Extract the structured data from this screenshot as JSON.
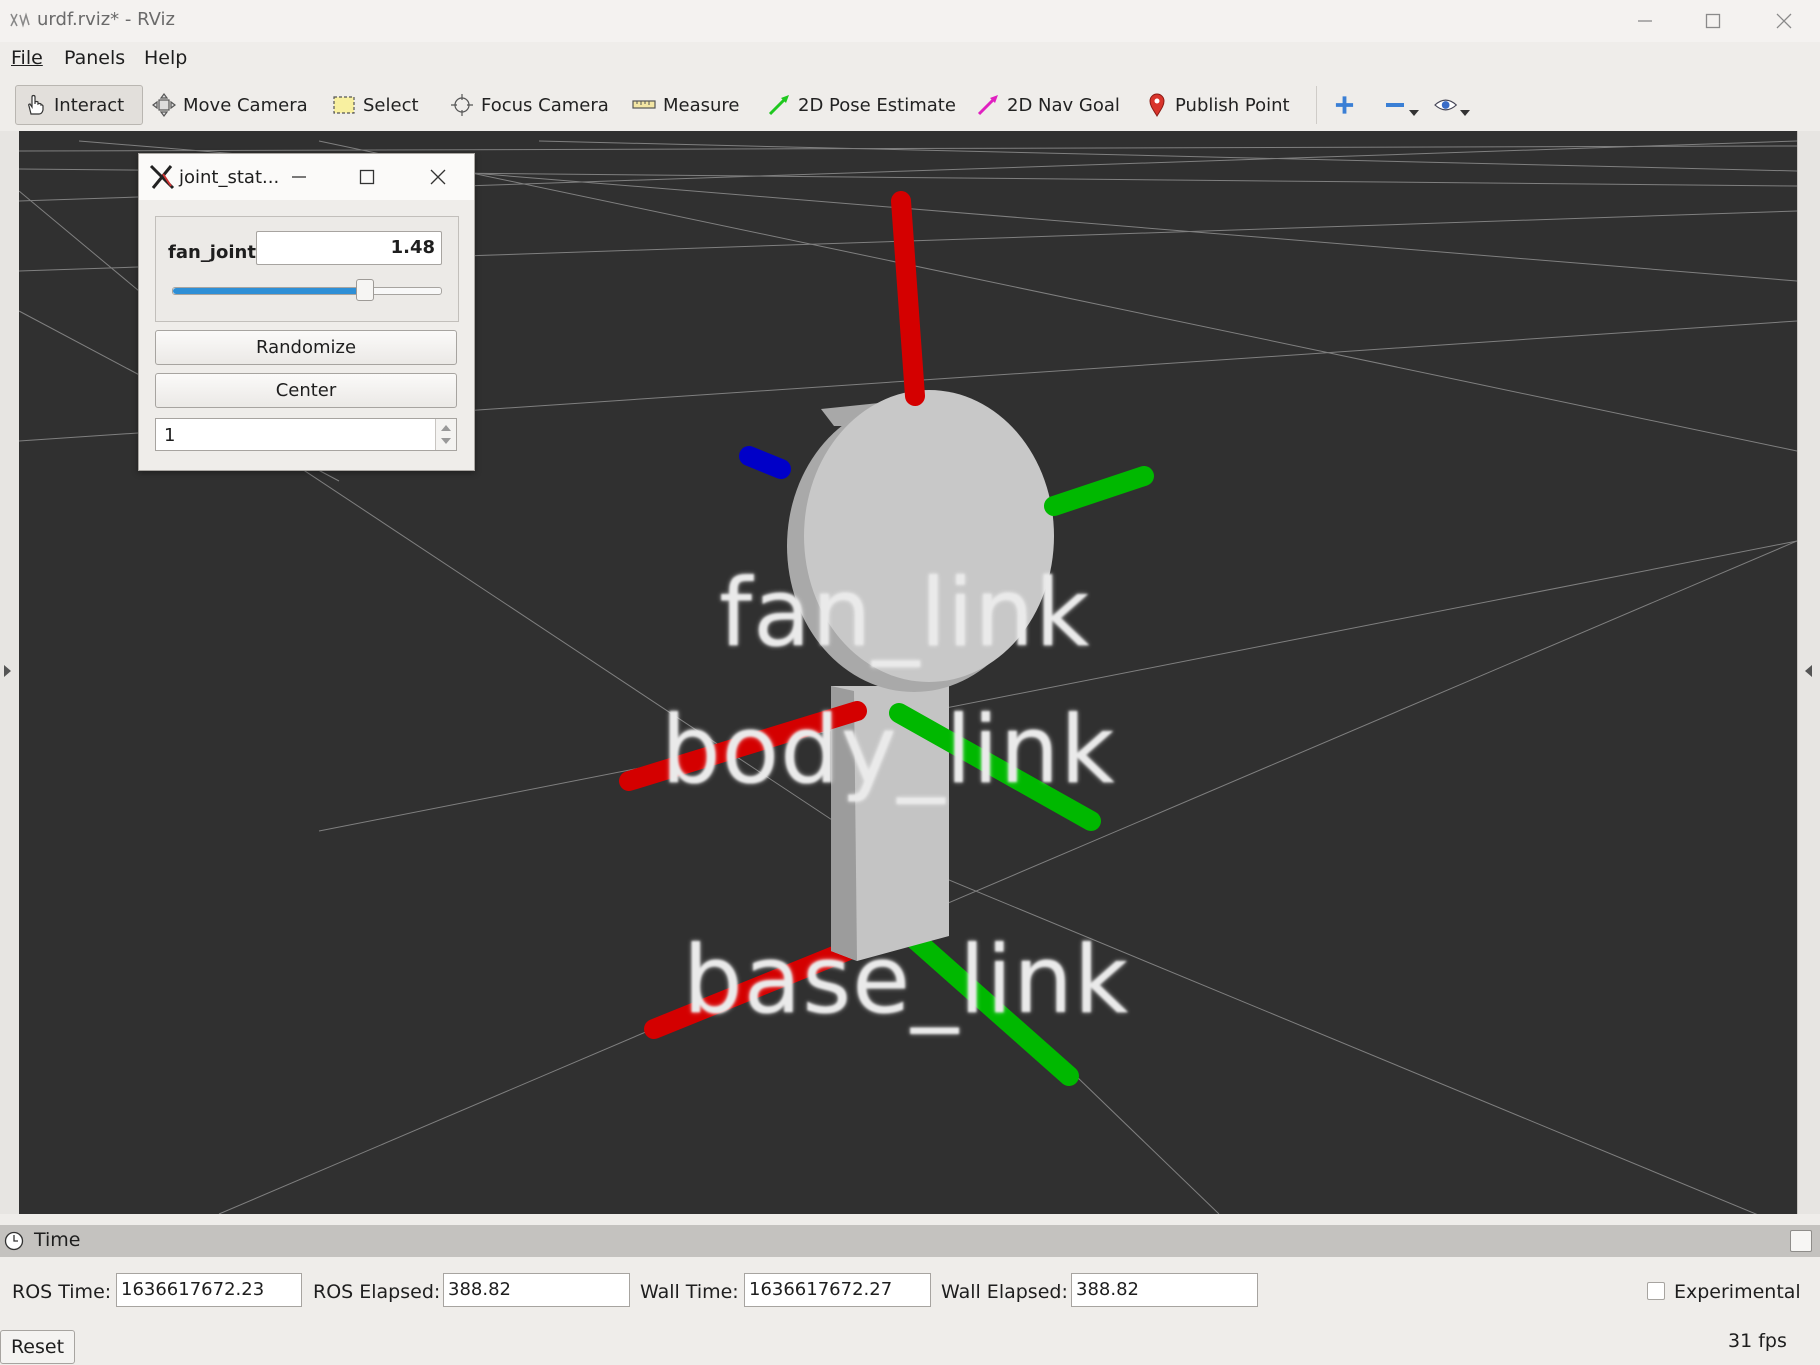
{
  "window": {
    "title": "urdf.rviz* - RViz"
  },
  "menu": {
    "file": "File",
    "panels": "Panels",
    "help": "Help"
  },
  "toolbar": {
    "interact": "Interact",
    "move_camera": "Move Camera",
    "select": "Select",
    "focus_camera": "Focus Camera",
    "measure": "Measure",
    "pose_estimate": "2D Pose Estimate",
    "nav_goal": "2D Nav Goal",
    "publish_point": "Publish Point"
  },
  "joint_window": {
    "title": "joint_stat...",
    "joint_name": "fan_joint",
    "joint_value": "1.48",
    "slider_fraction": 0.72,
    "randomize": "Randomize",
    "center": "Center",
    "spin_value": "1"
  },
  "scene": {
    "labels": {
      "fan": "fan_link",
      "body": "body_link",
      "base": "base_link"
    },
    "colors": {
      "background": "#303030",
      "x_axis": "#e00000",
      "y_axis": "#00c800",
      "z_axis": "#0000d0",
      "link": "#c9c9c9"
    }
  },
  "time_panel": {
    "header": "Time",
    "ros_time_label": "ROS Time:",
    "ros_time": "1636617672.23",
    "ros_elapsed_label": "ROS Elapsed:",
    "ros_elapsed": "388.82",
    "wall_time_label": "Wall Time:",
    "wall_time": "1636617672.27",
    "wall_elapsed_label": "Wall Elapsed:",
    "wall_elapsed": "388.82",
    "experimental": "Experimental",
    "reset": "Reset",
    "fps": "31 fps"
  }
}
